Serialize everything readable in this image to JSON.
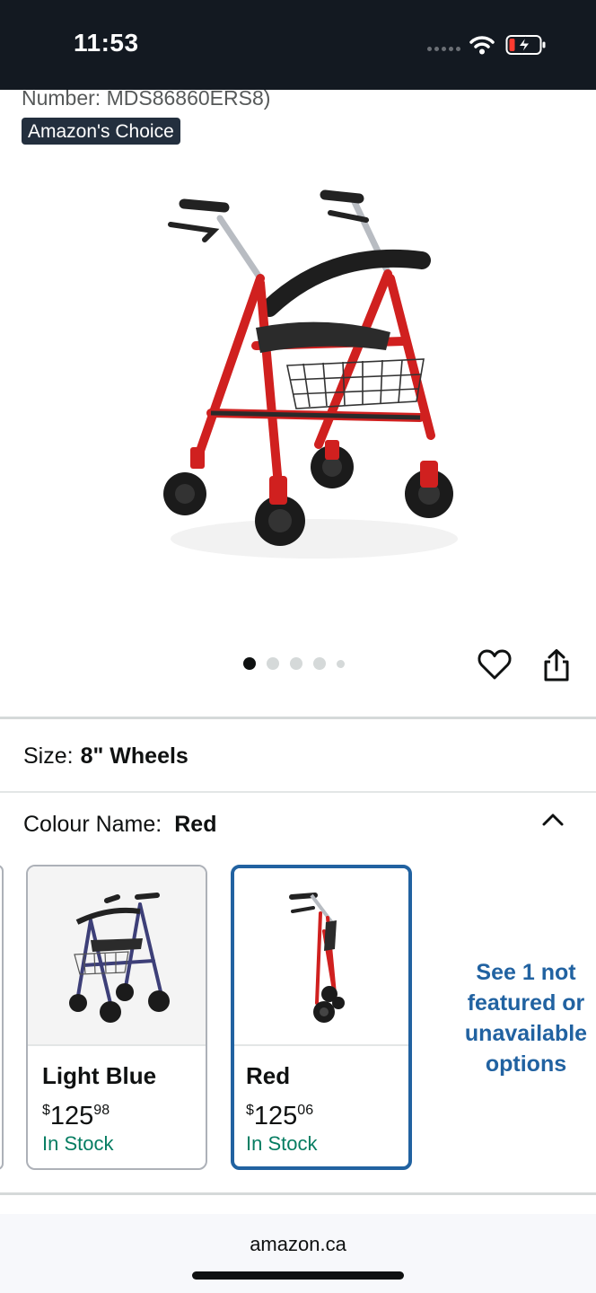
{
  "status_bar": {
    "time": "11:53",
    "icons": [
      "signal-dots-icon",
      "wifi-icon",
      "battery-charging-icon"
    ]
  },
  "product": {
    "model_number_text": "Number: MDS86860ERS8)",
    "badge": "Amazon's Choice",
    "image_icon": "rollator-walker-red-image",
    "carousel": {
      "total": 5,
      "active": 1
    },
    "actions": {
      "wishlist_icon": "heart-icon",
      "share_icon": "share-icon"
    }
  },
  "size": {
    "label": "Size:",
    "value": "8\" Wheels"
  },
  "colour": {
    "label": "Colour Name:",
    "value": "Red",
    "options": [
      {
        "name": "Light Blue",
        "currency": "$",
        "dollars": "125",
        "cents": "98",
        "stock": "In Stock",
        "selected": false
      },
      {
        "name": "Red",
        "currency": "$",
        "dollars": "125",
        "cents": "06",
        "stock": "In Stock",
        "selected": true
      }
    ],
    "see_more": "See 1 not featured or unavailable options"
  },
  "browser": {
    "url": "amazon.ca"
  },
  "colors": {
    "header_bg": "#131921",
    "badge_bg": "#232f3e",
    "link_blue": "#2162a1",
    "in_stock_green": "#067d62",
    "walker_red": "#d0201f"
  }
}
